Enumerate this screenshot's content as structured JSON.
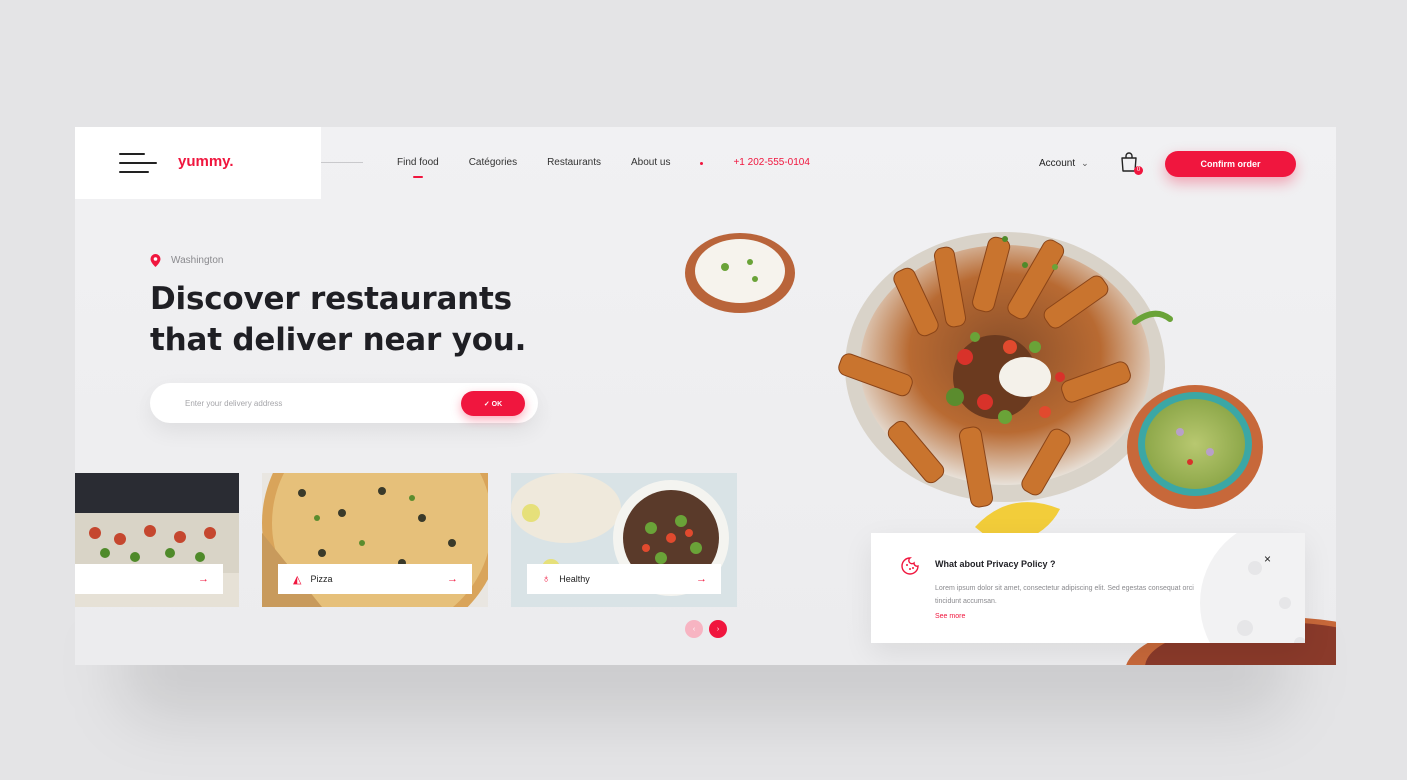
{
  "header": {
    "logo": "yummy.",
    "nav": [
      "Find food",
      "Catégories",
      "Restaurants",
      "About us"
    ],
    "phone": "+1 202-555-0104",
    "account": "Account",
    "cart_count": "0",
    "confirm_label": "Confirm order"
  },
  "hero": {
    "location": "Washington",
    "headline_line1": "Discover restaurants",
    "headline_line2": "that deliver near you.",
    "search_placeholder": "Enter your delivery address",
    "ok_label": "✓ OK"
  },
  "categories": [
    {
      "label": "Pizza",
      "icon": "pizza-icon"
    },
    {
      "label": "Healthy",
      "icon": "apple-icon"
    }
  ],
  "privacy": {
    "title": "What about Privacy Policy ?",
    "body": "Lorem ipsum dolor sit amet, consectetur adipiscing elit. Sed egestas consequat orci tincidunt accumsan.",
    "link": "See more",
    "close": "×"
  },
  "colors": {
    "accent": "#f0163e",
    "text_dark": "#1f1f24",
    "text_muted": "#8a8a8e",
    "page_bg": "#e4e4e6"
  }
}
